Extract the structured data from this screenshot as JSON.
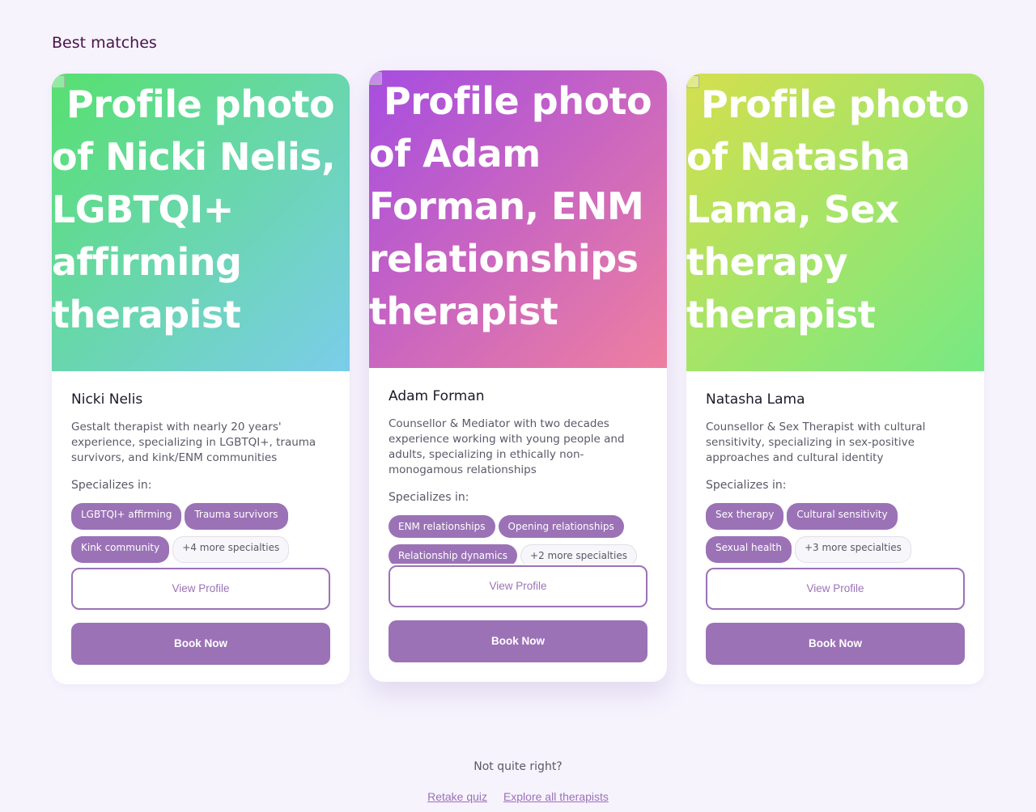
{
  "heading": "Best matches",
  "specializes_label": "Specializes in:",
  "view_label": "View Profile",
  "book_label": "Book Now",
  "cards": [
    {
      "photo_alt": "Profile photo of Nicki Nelis, LGBTQI+ affirming therapist",
      "gradient": [
        "#57e070",
        "#7bcdea"
      ],
      "name": "Nicki Nelis",
      "description": "Gestalt therapist with nearly 20 years' experience, specializing in LGBTQI+, trauma survivors, and kink/ENM communities",
      "tags": [
        "LGBTQI+ affirming",
        "Trauma survivors",
        "Kink community"
      ],
      "more": "+4 more specialties"
    },
    {
      "photo_alt": "Profile photo of Adam Forman, ENM relationships therapist",
      "gradient": [
        "#a64de0",
        "#ee7fa0"
      ],
      "name": "Adam Forman",
      "description": "Counsellor & Mediator with two decades experience working with young people and adults, specializing in ethically non-monogamous relationships",
      "tags": [
        "ENM relationships",
        "Opening relationships",
        "Relationship dynamics"
      ],
      "more": "+2 more specialties"
    },
    {
      "photo_alt": "Profile photo of Natasha Lama, Sex therapy therapist",
      "gradient": [
        "#d4df4d",
        "#76e983"
      ],
      "name": "Natasha Lama",
      "description": "Counsellor & Sex Therapist with cultural sensitivity, specializing in sex-positive approaches and cultural identity",
      "tags": [
        "Sex therapy",
        "Cultural sensitivity",
        "Sexual health"
      ],
      "more": "+3 more specialties"
    }
  ],
  "footer": {
    "question": "Not quite right?",
    "retake": "Retake quiz",
    "explore": "Explore all therapists"
  }
}
